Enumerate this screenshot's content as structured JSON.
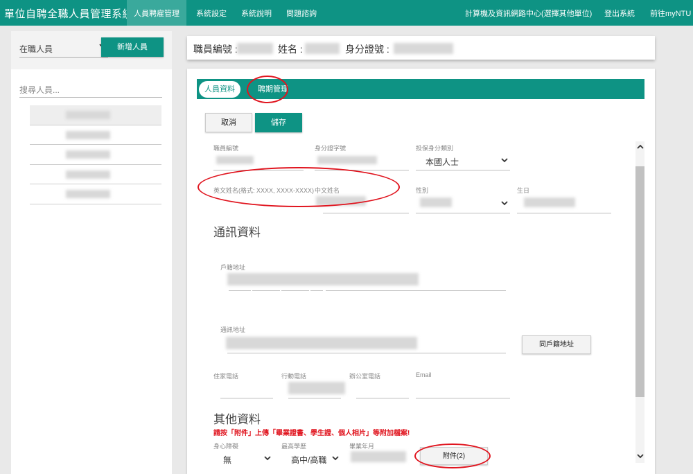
{
  "app": {
    "title": "單位自聘全職人員管理系統"
  },
  "nav": {
    "items": [
      {
        "label": "人員聘雇管理",
        "active": true
      },
      {
        "label": "系統設定"
      },
      {
        "label": "系統說明"
      },
      {
        "label": "問題諮詢"
      }
    ],
    "right": [
      {
        "label": "計算機及資訊網路中心(選擇其他單位)"
      },
      {
        "label": "登出系統"
      },
      {
        "label": "前往myNTU"
      }
    ]
  },
  "left": {
    "status_select": "在職人員",
    "add_button": "新增人員",
    "search_placeholder": "搜尋人員..."
  },
  "info": {
    "emp_no_label": "職員編號 :",
    "name_label": "姓名 :",
    "id_label": "身分證號 :"
  },
  "tabs": [
    {
      "label": "人員資料",
      "active": true
    },
    {
      "label": "聘期管理"
    }
  ],
  "actions": {
    "cancel": "取消",
    "save": "儲存"
  },
  "form": {
    "emp_no": "職員編號",
    "id_no": "身分證字號",
    "insure_type": "投保身分類別",
    "insure_value": "本國人士",
    "eng_name": "英文姓名(格式: XXXX, XXXX-XXXX)",
    "cn_name": "中文姓名",
    "gender": "性別",
    "birthday": "生日",
    "contact_section": "通訊資料",
    "household_addr": "戶籍地址",
    "mail_addr": "通訊地址",
    "same_addr_button": "同戶籍地址",
    "home_phone": "住家電話",
    "mobile": "行動電話",
    "office_phone": "辦公室電話",
    "email": "Email",
    "other_section": "其他資料",
    "upload_hint": "請按「附件」上傳「畢業證書、學生證、個人相片」等附加檔案!",
    "disability": "身心障礙",
    "disability_value": "無",
    "education": "最高學歷",
    "education_value": "高中/高職",
    "grad_date": "畢業年月",
    "attachment_button": "附件(2)"
  },
  "colors": {
    "brand": "#0e9384",
    "highlight": "#e0141e"
  }
}
